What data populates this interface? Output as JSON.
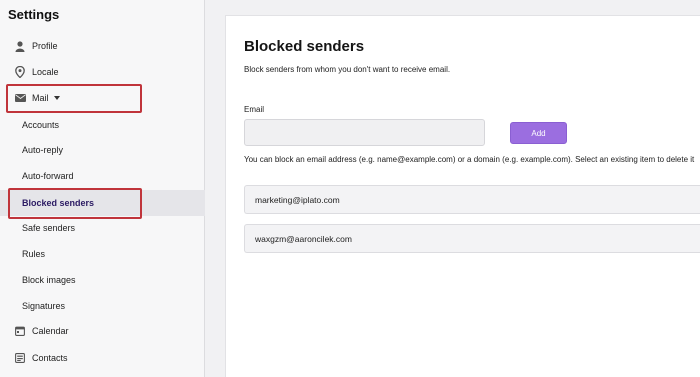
{
  "sidebar": {
    "title": "Settings",
    "items": [
      {
        "label": "Profile",
        "icon": "person-icon"
      },
      {
        "label": "Locale",
        "icon": "location-pin-icon"
      },
      {
        "label": "Mail",
        "icon": "envelope-icon"
      },
      {
        "label": "Accounts"
      },
      {
        "label": "Auto-reply"
      },
      {
        "label": "Auto-forward"
      },
      {
        "label": "Blocked senders"
      },
      {
        "label": "Safe senders"
      },
      {
        "label": "Rules"
      },
      {
        "label": "Block images"
      },
      {
        "label": "Signatures"
      },
      {
        "label": "Calendar",
        "icon": "calendar-icon"
      },
      {
        "label": "Contacts",
        "icon": "contacts-icon"
      }
    ],
    "active_item": "Blocked senders"
  },
  "main": {
    "title": "Blocked senders",
    "description": "Block senders from whom you don't want to receive email.",
    "email_label": "Email",
    "email_value": "",
    "add_button": "Add",
    "help_text": "You can block an email address (e.g. name@example.com) or a domain (e.g. example.com). Select an existing item to delete it",
    "blocked_list": [
      "marketing@iplato.com",
      "waxgzm@aaroncilek.com"
    ]
  },
  "colors": {
    "accent": "#9b6ee0",
    "active_text": "#2b1a63",
    "annotation_box": "#c0343b"
  }
}
